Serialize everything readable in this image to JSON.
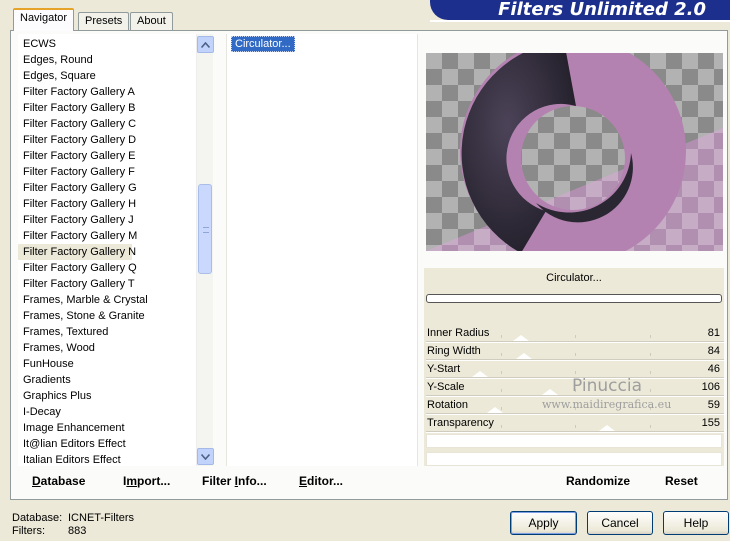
{
  "banner": {
    "title": "Filters Unlimited 2.0"
  },
  "tabs": [
    {
      "label": "Navigator",
      "active": true
    },
    {
      "label": "Presets",
      "active": false
    },
    {
      "label": "About",
      "active": false
    }
  ],
  "filter_list": {
    "items": [
      "ECWS",
      "Edges, Round",
      "Edges, Square",
      "Filter Factory Gallery A",
      "Filter Factory Gallery B",
      "Filter Factory Gallery C",
      "Filter Factory Gallery D",
      "Filter Factory Gallery E",
      "Filter Factory Gallery F",
      "Filter Factory Gallery G",
      "Filter Factory Gallery H",
      "Filter Factory Gallery J",
      "Filter Factory Gallery M",
      "Filter Factory Gallery N",
      "Filter Factory Gallery Q",
      "Filter Factory Gallery T",
      "Frames, Marble & Crystal",
      "Frames, Stone & Granite",
      "Frames, Textured",
      "Frames, Wood",
      "FunHouse",
      "Gradients",
      "Graphics Plus",
      "I-Decay",
      "Image Enhancement",
      "It@lian Editors Effect",
      "Italian Editors Effect"
    ],
    "selected": "Filter Factory Gallery N"
  },
  "effects_list": {
    "items": [
      "Circulator..."
    ],
    "selected": "Circulator..."
  },
  "left_buttons": {
    "database": {
      "underline": "D",
      "rest": "atabase"
    },
    "import": {
      "pre": "I",
      "underline": "m",
      "rest": "port..."
    },
    "filter_info": {
      "pre": "Filter ",
      "underline": "I",
      "rest": "nfo..."
    },
    "editor": {
      "underline": "E",
      "rest": "ditor..."
    }
  },
  "filter_name": "Circulator...",
  "params": [
    {
      "label": "Inner Radius",
      "value": 81
    },
    {
      "label": "Ring Width",
      "value": 84
    },
    {
      "label": "Y-Start",
      "value": 46
    },
    {
      "label": "Y-Scale",
      "value": 106
    },
    {
      "label": "Rotation",
      "value": 59
    },
    {
      "label": "Transparency",
      "value": 155
    }
  ],
  "right_buttons": {
    "randomize": "Randomize",
    "reset": "Reset"
  },
  "watermark": {
    "name": "Pinuccia",
    "url": "www.maidiregrafica.eu"
  },
  "status": {
    "database_label": "Database:",
    "database_value": "ICNET-Filters",
    "filters_label": "Filters:",
    "filters_value": "883"
  },
  "dialog_buttons": {
    "apply": "Apply",
    "cancel": "Cancel",
    "help": "Help"
  },
  "colors": {
    "banner": "#1d2f8c",
    "selection": "#316ac5",
    "ring_light": "#b482b0",
    "ring_dark": "#2a2733"
  }
}
